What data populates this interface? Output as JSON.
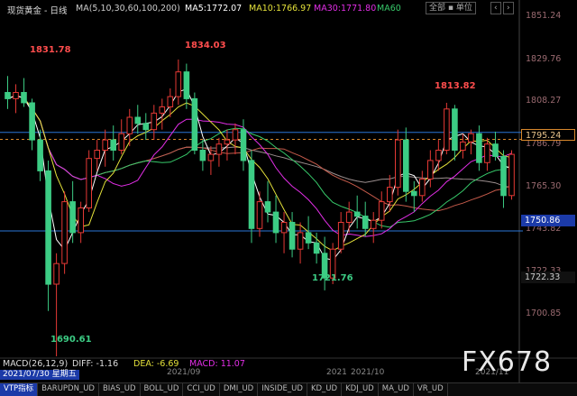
{
  "title": "现货黄金 - 日线",
  "ma_header": {
    "label": "MA(5,10,30,60,100,200)",
    "ma5": "MA5:1772.07",
    "ma10": "MA10:1766.97",
    "ma30": "MA30:1771.80",
    "ma60": "MA60"
  },
  "controls": {
    "scope": "全部 ▪ 单位",
    "prev": "‹",
    "next": "›"
  },
  "price_axis": [
    "1851.24",
    "1829.76",
    "1808.27",
    "1786.79",
    "1765.30",
    "1743.82",
    "1722.33",
    "1700.85"
  ],
  "markers": {
    "current_price": "1795.24",
    "h_line_price": "1750.86",
    "low_right": "1722.33"
  },
  "annotations": [
    "1831.78",
    "1834.03",
    "1813.82",
    "1721.76",
    "1690.61"
  ],
  "macd": {
    "label": "MACD(26,12,9)",
    "diff": "DIFF: -1.16",
    "dea": "DEA: -6.69",
    "macd": "MACD: 11.07"
  },
  "date_box": "2021/07/30 星期五",
  "x_labels": [
    "2021/09",
    "2021",
    "2021/10",
    "2021/11"
  ],
  "tabs": [
    "VTP指标",
    "BARUPDN_UD",
    "BIAS_UD",
    "BOLL_UD",
    "CCI_UD",
    "DMI_UD",
    "INSIDE_UD",
    "KD_UD",
    "KDJ_UD",
    "MA_UD",
    "VR_UD"
  ],
  "watermark": "FX678",
  "colors": {
    "up": "#e53935",
    "down": "#3ccc84",
    "ma5": "#ffffff",
    "ma10": "#e4e13a",
    "ma30": "#e22ee6",
    "ma60": "#37c96a",
    "ma_long": "#c45a4a",
    "ma_200": "#9b8e8e",
    "hline": "#2a76d6",
    "dash": "#d8882c"
  },
  "chart_data": {
    "type": "candlestick",
    "price_range": [
      1690,
      1855
    ],
    "candles": [
      [
        1818,
        1826,
        1810,
        1815
      ],
      [
        1815,
        1822,
        1808,
        1818
      ],
      [
        1818,
        1825,
        1811,
        1813
      ],
      [
        1813,
        1815,
        1790,
        1795
      ],
      [
        1795,
        1800,
        1775,
        1780
      ],
      [
        1780,
        1785,
        1712,
        1725
      ],
      [
        1725,
        1740,
        1690,
        1735
      ],
      [
        1735,
        1770,
        1730,
        1765
      ],
      [
        1765,
        1775,
        1745,
        1750
      ],
      [
        1750,
        1765,
        1745,
        1762
      ],
      [
        1762,
        1790,
        1760,
        1786
      ],
      [
        1786,
        1795,
        1780,
        1790
      ],
      [
        1790,
        1800,
        1782,
        1795
      ],
      [
        1795,
        1802,
        1785,
        1790
      ],
      [
        1790,
        1805,
        1788,
        1798
      ],
      [
        1798,
        1810,
        1792,
        1806
      ],
      [
        1806,
        1812,
        1798,
        1803
      ],
      [
        1803,
        1808,
        1795,
        1800
      ],
      [
        1800,
        1812,
        1795,
        1808
      ],
      [
        1808,
        1815,
        1800,
        1811
      ],
      [
        1811,
        1820,
        1806,
        1816
      ],
      [
        1816,
        1834,
        1812,
        1828
      ],
      [
        1828,
        1832,
        1810,
        1815
      ],
      [
        1815,
        1818,
        1788,
        1790
      ],
      [
        1790,
        1795,
        1780,
        1785
      ],
      [
        1785,
        1792,
        1778,
        1788
      ],
      [
        1788,
        1796,
        1782,
        1793
      ],
      [
        1793,
        1800,
        1785,
        1795
      ],
      [
        1795,
        1803,
        1788,
        1800
      ],
      [
        1800,
        1805,
        1780,
        1785
      ],
      [
        1785,
        1790,
        1745,
        1752
      ],
      [
        1752,
        1770,
        1748,
        1765
      ],
      [
        1765,
        1775,
        1755,
        1760
      ],
      [
        1760,
        1768,
        1745,
        1750
      ],
      [
        1750,
        1760,
        1740,
        1755
      ],
      [
        1755,
        1760,
        1738,
        1742
      ],
      [
        1742,
        1755,
        1735,
        1750
      ],
      [
        1750,
        1758,
        1742,
        1745
      ],
      [
        1745,
        1750,
        1735,
        1740
      ],
      [
        1740,
        1748,
        1722,
        1728
      ],
      [
        1728,
        1745,
        1725,
        1742
      ],
      [
        1742,
        1760,
        1740,
        1755
      ],
      [
        1755,
        1765,
        1750,
        1760
      ],
      [
        1760,
        1768,
        1752,
        1758
      ],
      [
        1758,
        1765,
        1748,
        1752
      ],
      [
        1752,
        1760,
        1745,
        1756
      ],
      [
        1756,
        1770,
        1752,
        1765
      ],
      [
        1765,
        1778,
        1760,
        1772
      ],
      [
        1772,
        1800,
        1768,
        1795
      ],
      [
        1795,
        1801,
        1765,
        1770
      ],
      [
        1770,
        1775,
        1760,
        1768
      ],
      [
        1768,
        1780,
        1765,
        1776
      ],
      [
        1776,
        1790,
        1772,
        1785
      ],
      [
        1785,
        1795,
        1780,
        1790
      ],
      [
        1790,
        1813,
        1788,
        1810
      ],
      [
        1810,
        1812,
        1785,
        1790
      ],
      [
        1790,
        1798,
        1786,
        1794
      ],
      [
        1794,
        1800,
        1788,
        1798
      ],
      [
        1798,
        1802,
        1780,
        1784
      ],
      [
        1784,
        1796,
        1780,
        1793
      ],
      [
        1793,
        1799,
        1785,
        1787
      ],
      [
        1787,
        1790,
        1762,
        1768
      ],
      [
        1768,
        1790,
        1766,
        1788
      ]
    ]
  }
}
